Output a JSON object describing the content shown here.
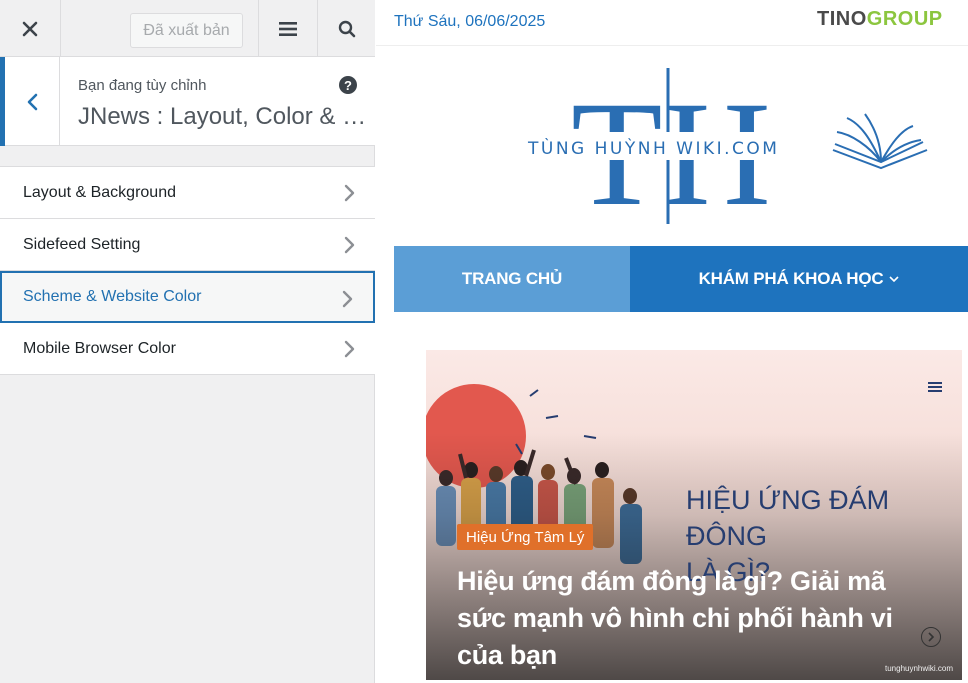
{
  "sidebar": {
    "published_label": "Đã xuất bản",
    "section_sub": "Bạn đang tùy chỉnh",
    "section_title": "JNews : Layout, Color & Scheme",
    "items": [
      {
        "label": "Layout & Background"
      },
      {
        "label": "Sidefeed Setting"
      },
      {
        "label": "Scheme & Website Color"
      },
      {
        "label": "Mobile Browser Color"
      }
    ]
  },
  "preview": {
    "date": "Thứ Sáu, 06/06/2025",
    "brand_part1": "TINO",
    "brand_part2": "GROUP",
    "logo_letters": "TH",
    "logo_text": "TÙNG HUỲNH WIKI.COM",
    "nav": {
      "home": "TRANG CHỦ",
      "explore": "KHÁM PHÁ KHOA HỌC"
    },
    "hero": {
      "heading_line1": "HIỆU ỨNG ĐÁM ĐÔNG",
      "heading_line2": "LÀ GÌ?",
      "badge": "Hiệu Ứng Tâm Lý",
      "title": "Hiệu ứng đám đông là gì? Giải mã sức mạnh vô hình chi phối hành vi của bạn",
      "watermark": "tunghuynhwiki.com"
    }
  },
  "colors": {
    "accent": "#2271b1",
    "nav_bg": "#1e73be",
    "nav_active": "#5b9ed6",
    "badge": "#e0702a",
    "brand_green": "#8cc63f"
  }
}
